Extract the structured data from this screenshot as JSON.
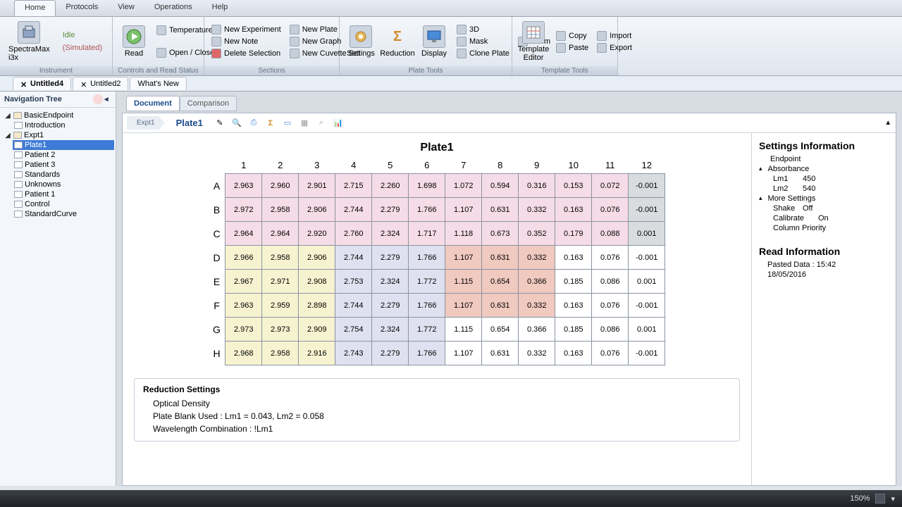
{
  "menu": {
    "items": [
      "Home",
      "Protocols",
      "View",
      "Operations",
      "Help"
    ],
    "active": 0
  },
  "ribbon": {
    "instrument": {
      "label": "Instrument",
      "device": "SpectraMax i3x",
      "status": "Idle",
      "mode": "(Simulated)"
    },
    "controls": {
      "label": "Controls and Read Status",
      "read": "Read",
      "temp": "Temperature",
      "openclose": "Open / Close"
    },
    "sections": {
      "label": "Sections",
      "items": [
        "New Experiment",
        "New Plate",
        "New Note",
        "New Graph",
        "Delete Selection",
        "New Cuvette Set"
      ]
    },
    "platetools": {
      "label": "Plate Tools",
      "settings": "Settings",
      "reduction": "Reduction",
      "display": "Display",
      "threeD": "3D",
      "zoom": "Zoom",
      "mask": "Mask",
      "clone": "Clone Plate"
    },
    "template": {
      "label": "Template Tools",
      "editor": "Template Editor",
      "copy": "Copy",
      "import": "Import",
      "paste": "Paste",
      "export": "Export"
    }
  },
  "doctabs": [
    "Untitled4",
    "Untitled2",
    "What's New"
  ],
  "nav": {
    "title": "Navigation Tree",
    "nodes": [
      {
        "label": "BasicEndpoint",
        "children": [
          {
            "label": "Introduction"
          }
        ]
      },
      {
        "label": "Expt1",
        "children": [
          {
            "label": "Plate1",
            "sel": true
          },
          {
            "label": "Patient 2"
          },
          {
            "label": "Patient 3"
          },
          {
            "label": "Standards"
          },
          {
            "label": "Unknowns"
          },
          {
            "label": "Patient 1"
          },
          {
            "label": "Control"
          },
          {
            "label": "StandardCurve"
          }
        ]
      }
    ]
  },
  "viewtabs": [
    "Document",
    "Comparison"
  ],
  "breadcrumb": {
    "root": "Expt1",
    "current": "Plate1"
  },
  "plate": {
    "title": "Plate1",
    "cols": [
      "1",
      "2",
      "3",
      "4",
      "5",
      "6",
      "7",
      "8",
      "9",
      "10",
      "11",
      "12"
    ],
    "rows": [
      "A",
      "B",
      "C",
      "D",
      "E",
      "F",
      "G",
      "H"
    ],
    "cells": [
      [
        "2.963",
        "2.960",
        "2.901",
        "2.715",
        "2.260",
        "1.698",
        "1.072",
        "0.594",
        "0.316",
        "0.153",
        "0.072",
        "-0.001"
      ],
      [
        "2.972",
        "2.958",
        "2.906",
        "2.744",
        "2.279",
        "1.766",
        "1.107",
        "0.631",
        "0.332",
        "0.163",
        "0.076",
        "-0.001"
      ],
      [
        "2.964",
        "2.964",
        "2.920",
        "2.760",
        "2.324",
        "1.717",
        "1.118",
        "0.673",
        "0.352",
        "0.179",
        "0.088",
        "0.001"
      ],
      [
        "2.966",
        "2.958",
        "2.906",
        "2.744",
        "2.279",
        "1.766",
        "1.107",
        "0.631",
        "0.332",
        "0.163",
        "0.076",
        "-0.001"
      ],
      [
        "2.967",
        "2.971",
        "2.908",
        "2.753",
        "2.324",
        "1.772",
        "1.115",
        "0.654",
        "0.366",
        "0.185",
        "0.086",
        "0.001"
      ],
      [
        "2.963",
        "2.959",
        "2.898",
        "2.744",
        "2.279",
        "1.766",
        "1.107",
        "0.631",
        "0.332",
        "0.163",
        "0.076",
        "-0.001"
      ],
      [
        "2.973",
        "2.973",
        "2.909",
        "2.754",
        "2.324",
        "1.772",
        "1.115",
        "0.654",
        "0.366",
        "0.185",
        "0.086",
        "0.001"
      ],
      [
        "2.968",
        "2.958",
        "2.916",
        "2.743",
        "2.279",
        "1.766",
        "1.107",
        "0.631",
        "0.332",
        "0.163",
        "0.076",
        "-0.001"
      ]
    ],
    "colors": [
      [
        "p",
        "p",
        "p",
        "p",
        "p",
        "p",
        "p",
        "p",
        "p",
        "p",
        "p",
        "g"
      ],
      [
        "p",
        "p",
        "p",
        "p",
        "p",
        "p",
        "p",
        "p",
        "p",
        "p",
        "p",
        "g"
      ],
      [
        "p",
        "p",
        "p",
        "p",
        "p",
        "p",
        "p",
        "p",
        "p",
        "p",
        "p",
        "g"
      ],
      [
        "y",
        "y",
        "y",
        "l",
        "l",
        "l",
        "s",
        "s",
        "s",
        "w",
        "w",
        "w"
      ],
      [
        "y",
        "y",
        "y",
        "l",
        "l",
        "l",
        "s",
        "s",
        "s",
        "w",
        "w",
        "w"
      ],
      [
        "y",
        "y",
        "y",
        "l",
        "l",
        "l",
        "s",
        "s",
        "s",
        "w",
        "w",
        "w"
      ],
      [
        "y",
        "y",
        "y",
        "l",
        "l",
        "l",
        "w",
        "w",
        "w",
        "w",
        "w",
        "w"
      ],
      [
        "y",
        "y",
        "y",
        "l",
        "l",
        "l",
        "w",
        "w",
        "w",
        "w",
        "w",
        "w"
      ]
    ]
  },
  "reduction": {
    "title": "Reduction Settings",
    "lines": [
      "Optical Density",
      "Plate Blank Used : Lm1 = 0.043, Lm2 = 0.058",
      "Wavelength Combination : !Lm1"
    ]
  },
  "settings": {
    "title": "Settings Information",
    "endpoint": "Endpoint",
    "absorbance": "Absorbance",
    "lm1": {
      "k": "Lm1",
      "v": "450"
    },
    "lm2": {
      "k": "Lm2",
      "v": "540"
    },
    "more": "More Settings",
    "shake": {
      "k": "Shake",
      "v": "Off"
    },
    "calibrate": {
      "k": "Calibrate",
      "v": "On"
    },
    "priority": "Column Priority"
  },
  "readinfo": {
    "title": "Read Information",
    "pasted": "Pasted Data : 15:42",
    "date": "18/05/2016"
  },
  "statusbar": {
    "zoom": "150%"
  }
}
